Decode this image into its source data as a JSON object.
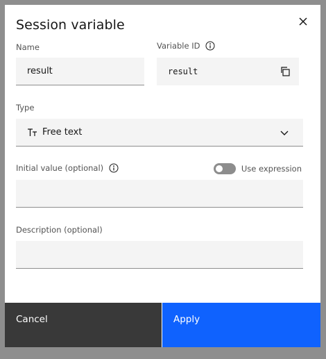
{
  "modal": {
    "title": "Session variable",
    "close_icon": "close-icon"
  },
  "name_field": {
    "label": "Name",
    "value": "result"
  },
  "variable_id": {
    "label": "Variable ID",
    "value": "result",
    "info_icon": "info-icon",
    "copy_icon": "copy-icon"
  },
  "type_field": {
    "label": "Type",
    "value": "Free text",
    "type_icon": "text-type-icon",
    "chevron_icon": "chevron-down-icon"
  },
  "initial_value": {
    "label": "Initial value (optional)",
    "value": "",
    "info_icon": "info-icon"
  },
  "use_expression": {
    "label": "Use expression",
    "enabled": false
  },
  "description": {
    "label": "Description (optional)",
    "value": ""
  },
  "footer": {
    "cancel_label": "Cancel",
    "apply_label": "Apply"
  },
  "colors": {
    "primary": "#0f62fe",
    "secondary": "#393939",
    "field_bg": "#f4f4f4",
    "toggle_off": "#8d8d8d"
  }
}
